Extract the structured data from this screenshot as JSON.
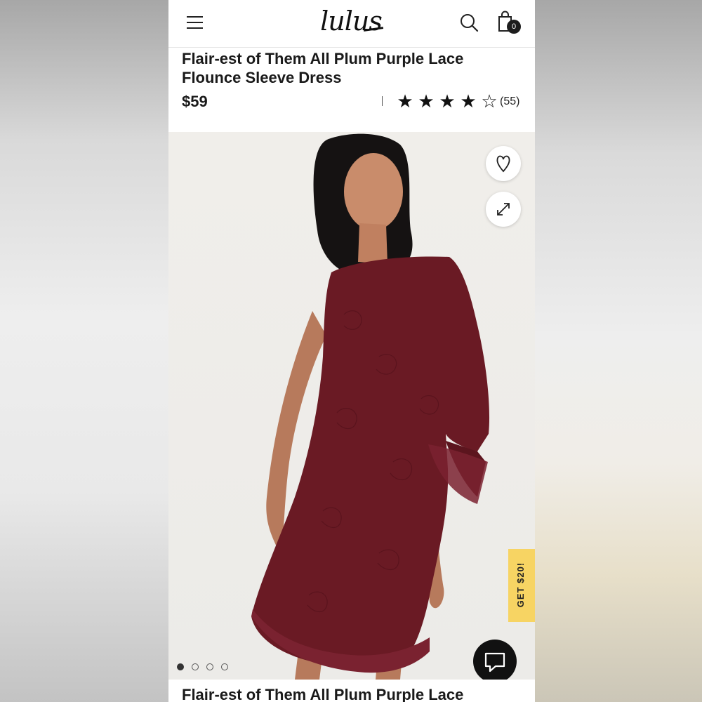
{
  "header": {
    "logo_text": "lulus",
    "cart_count": "0",
    "icons": [
      "menu-icon",
      "search-icon",
      "shopping-bag-icon"
    ]
  },
  "product": {
    "title": "Flair-est of Them All Plum Purple Lace Flounce Sleeve Dress",
    "price": "$59",
    "rating_stars_filled": 4,
    "rating_stars_total": 5,
    "review_count": "(55)",
    "image_description_color": "#6a1a24"
  },
  "gallery": {
    "current_index": 1,
    "total_images": 4,
    "icons": [
      "heart-icon",
      "expand-icon",
      "chat-icon"
    ]
  },
  "promo": {
    "label": "GET $20!",
    "color": "#f7d463"
  },
  "colors": {
    "accent": "#f7d463",
    "text": "#1a1a1a",
    "dress": "#6a1a24"
  }
}
